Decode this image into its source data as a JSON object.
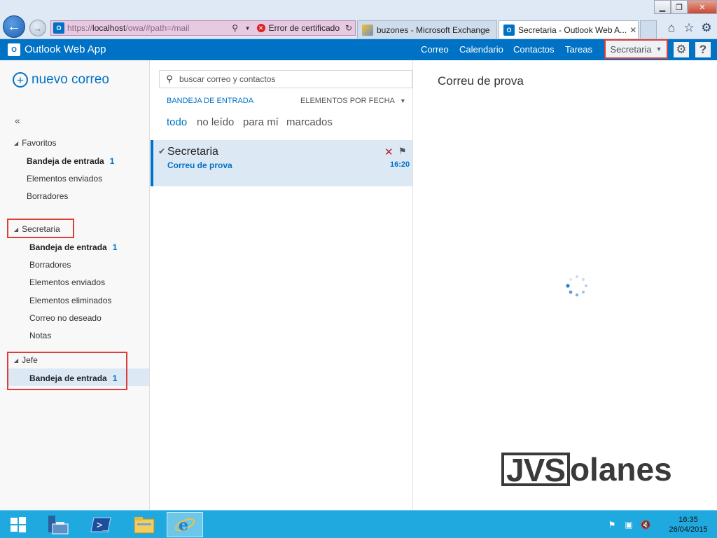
{
  "browser": {
    "window_controls": {
      "minimize": "▁",
      "restore": "❐",
      "close": "✕"
    },
    "address": {
      "scheme": "https://",
      "host": "localhost",
      "path": "/owa/#path=/mail",
      "cert_error": "Error de certificado"
    },
    "tabs": [
      {
        "label": "buzones - Microsoft Exchange"
      },
      {
        "label": "Secretaria - Outlook Web A..."
      }
    ]
  },
  "owa": {
    "app_title": "Outlook Web App",
    "nav": [
      "Correo",
      "Calendario",
      "Contactos",
      "Tareas"
    ],
    "mailbox_button": "Secretaria"
  },
  "folders": {
    "new_mail": "nuevo correo",
    "collapse": "«",
    "favorites": {
      "title": "Favoritos",
      "items": [
        {
          "label": "Bandeja de entrada",
          "count": "1"
        },
        {
          "label": "Elementos enviados"
        },
        {
          "label": "Borradores"
        }
      ]
    },
    "secretaria": {
      "title": "Secretaria",
      "items": [
        {
          "label": "Bandeja de entrada",
          "count": "1"
        },
        {
          "label": "Borradores"
        },
        {
          "label": "Elementos enviados"
        },
        {
          "label": "Elementos eliminados"
        },
        {
          "label": "Correo no deseado"
        },
        {
          "label": "Notas"
        }
      ]
    },
    "jefe": {
      "title": "Jefe",
      "items": [
        {
          "label": "Bandeja de entrada",
          "count": "1"
        }
      ]
    }
  },
  "list": {
    "search_placeholder": "buscar correo y contactos",
    "folder_label": "BANDEJA DE ENTRADA",
    "sort_label": "ELEMENTOS POR FECHA",
    "filters": [
      "todo",
      "no leído",
      "para mí",
      "marcados"
    ],
    "messages": [
      {
        "sender": "Secretaria",
        "subject": "Correu de prova",
        "time": "16:20"
      }
    ]
  },
  "reading": {
    "subject": "Correu de prova"
  },
  "watermark": {
    "box_text": "JVS",
    "rest_text": "olanes"
  },
  "taskbar": {
    "time": "16:35",
    "date": "26/04/2015"
  },
  "colors": {
    "owa_blue": "#0072c6",
    "highlight_red": "#d9403a",
    "taskbar": "#1fa9df"
  }
}
